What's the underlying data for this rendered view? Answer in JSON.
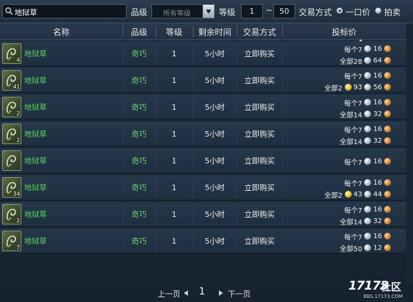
{
  "filters": {
    "search_value": "地狱草",
    "grade_label": "品级",
    "grade_value": "所有等级",
    "level_label": "等级",
    "level_min": "1",
    "level_sep": "~",
    "level_max": "50",
    "trade_label": "交易方式",
    "option_single": "一口价",
    "option_auction": "拍卖",
    "selected_option": "一口价"
  },
  "columns": [
    "名称",
    "品级",
    "等级",
    "剩余时间",
    "交易方式",
    "投标价"
  ],
  "rows": [
    {
      "name": "地狱草",
      "qty": "4",
      "grade": "奇巧",
      "level": "1",
      "time": "5小时",
      "trade": "立即购买",
      "each_label": "每个7",
      "each_copper": "16",
      "all_label": "全部28",
      "all_gold": "",
      "all_silver_extra": "64"
    },
    {
      "name": "地狱草",
      "qty": "41",
      "grade": "奇巧",
      "level": "1",
      "time": "5小时",
      "trade": "立即购买",
      "each_label": "每个7",
      "each_copper": "16",
      "all_label": "全部2",
      "all_gold": "93",
      "all_silver_extra": "56"
    },
    {
      "name": "地狱草",
      "qty": "2",
      "grade": "奇巧",
      "level": "1",
      "time": "5小时",
      "trade": "立即购买",
      "each_label": "每个7",
      "each_copper": "16",
      "all_label": "全部14",
      "all_gold": "",
      "all_silver_extra": "32"
    },
    {
      "name": "地狱草",
      "qty": "2",
      "grade": "奇巧",
      "level": "1",
      "time": "5小时",
      "trade": "立即购买",
      "each_label": "每个7",
      "each_copper": "16",
      "all_label": "全部14",
      "all_gold": "",
      "all_silver_extra": "32"
    },
    {
      "name": "地狱草",
      "qty": "",
      "grade": "奇巧",
      "level": "1",
      "time": "5小时",
      "trade": "立即购买",
      "each_label": "每个7",
      "each_copper": "16",
      "all_label": "",
      "all_gold": "",
      "all_silver_extra": ""
    },
    {
      "name": "地狱草",
      "qty": "34",
      "grade": "奇巧",
      "level": "1",
      "time": "5小时",
      "trade": "立即购买",
      "each_label": "每个7",
      "each_copper": "16",
      "all_label": "全部2",
      "all_gold": "43",
      "all_silver_extra": "44"
    },
    {
      "name": "地狱草",
      "qty": "2",
      "grade": "奇巧",
      "level": "1",
      "time": "5小时",
      "trade": "立即购买",
      "each_label": "每个7",
      "each_copper": "16",
      "all_label": "全部14",
      "all_gold": "",
      "all_silver_extra": "32"
    },
    {
      "name": "地狱草",
      "qty": "7",
      "grade": "奇巧",
      "level": "1",
      "time": "5小时",
      "trade": "立即购买",
      "each_label": "每个7",
      "each_copper": "16",
      "all_label": "全部50",
      "all_gold": "",
      "all_silver_extra": "12"
    }
  ],
  "pager": {
    "prev_label": "上一页",
    "page": "1",
    "next_label": "下一页"
  },
  "watermark": {
    "logo": "17173",
    "logo_cn": "社区",
    "url": "BBS.17173.COM"
  },
  "colors": {
    "item_name": "#5ed35e",
    "grade": "#6fd26f",
    "bg": "#1c2836"
  }
}
